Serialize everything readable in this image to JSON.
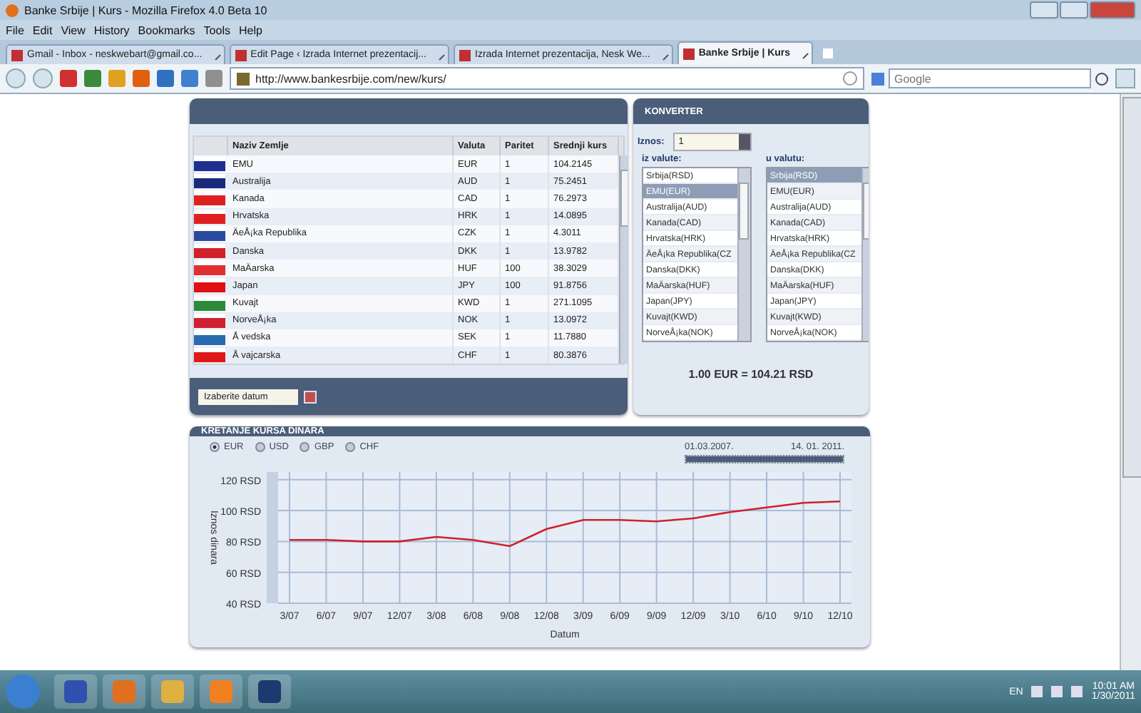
{
  "window": {
    "title": "Banke Srbije | Kurs - Mozilla Firefox 4.0 Beta 10"
  },
  "menu": [
    "File",
    "Edit",
    "View",
    "History",
    "Bookmarks",
    "Tools",
    "Help"
  ],
  "tabs": [
    {
      "label": "Gmail - Inbox - neskwebart@gmail.co...",
      "selected": false
    },
    {
      "label": "Edit Page ‹ Izrada Internet prezentacij...",
      "selected": false
    },
    {
      "label": "Izrada Internet prezentacija, Nesk We...",
      "selected": false
    },
    {
      "label": "Banke Srbije | Kurs",
      "selected": true
    }
  ],
  "address": {
    "url": "http://www.bankesrbije.com/new/kurs/"
  },
  "search": {
    "placeholder": "Google"
  },
  "rates": {
    "columns": [
      "Naziv Zemlje",
      "Valuta",
      "Paritet",
      "Srednji kurs"
    ],
    "rows": [
      {
        "country": "EMU",
        "currency": "EUR",
        "parity": "1",
        "rate": "104.2145",
        "color": "#1f2f8f"
      },
      {
        "country": "Australija",
        "currency": "AUD",
        "parity": "1",
        "rate": "75.2451",
        "color": "#1a2a7a"
      },
      {
        "country": "Kanada",
        "currency": "CAD",
        "parity": "1",
        "rate": "76.2973",
        "color": "#e02020"
      },
      {
        "country": "Hrvatska",
        "currency": "HRK",
        "parity": "1",
        "rate": "14.0895",
        "color": "#e02020"
      },
      {
        "country": "ÄeÅ¡ka Republika",
        "currency": "CZK",
        "parity": "1",
        "rate": "4.3011",
        "color": "#2a4aa0"
      },
      {
        "country": "Danska",
        "currency": "DKK",
        "parity": "1",
        "rate": "13.9782",
        "color": "#d0202a"
      },
      {
        "country": "MaÄarska",
        "currency": "HUF",
        "parity": "100",
        "rate": "38.3029",
        "color": "#e03030"
      },
      {
        "country": "Japan",
        "currency": "JPY",
        "parity": "100",
        "rate": "91.8756",
        "color": "#e01010"
      },
      {
        "country": "Kuvajt",
        "currency": "KWD",
        "parity": "1",
        "rate": "271.1095",
        "color": "#2a8a3a"
      },
      {
        "country": "NorveÅ¡ka",
        "currency": "NOK",
        "parity": "1",
        "rate": "13.0972",
        "color": "#d02030"
      },
      {
        "country": "Å vedska",
        "currency": "SEK",
        "parity": "1",
        "rate": "11.7880",
        "color": "#2a6ab0"
      },
      {
        "country": "Å vajcarska",
        "currency": "CHF",
        "parity": "1",
        "rate": "80.3876",
        "color": "#e01818"
      }
    ],
    "date_field": {
      "value": "Izaberite datum"
    }
  },
  "converter": {
    "title": "KONVERTER",
    "amount_label": "Iznos:",
    "amount": "1",
    "from_label": "iz valute:",
    "to_label": "u valutu:",
    "from": [
      {
        "label": "Srbija(RSD)",
        "selected": false
      },
      {
        "label": "EMU(EUR)",
        "selected": true
      },
      {
        "label": "Australija(AUD)",
        "selected": false
      },
      {
        "label": "Kanada(CAD)",
        "selected": false
      },
      {
        "label": "Hrvatska(HRK)",
        "selected": false
      },
      {
        "label": "ÄeÅ¡ka Republika(CZ",
        "selected": false
      },
      {
        "label": "Danska(DKK)",
        "selected": false
      },
      {
        "label": "MaÄarska(HUF)",
        "selected": false
      },
      {
        "label": "Japan(JPY)",
        "selected": false
      },
      {
        "label": "Kuvajt(KWD)",
        "selected": false
      },
      {
        "label": "NorveÅ¡ka(NOK)",
        "selected": false
      }
    ],
    "to": [
      {
        "label": "Srbija(RSD)",
        "selected": true
      },
      {
        "label": "EMU(EUR)",
        "selected": false
      },
      {
        "label": "Australija(AUD)",
        "selected": false
      },
      {
        "label": "Kanada(CAD)",
        "selected": false
      },
      {
        "label": "Hrvatska(HRK)",
        "selected": false
      },
      {
        "label": "ÄeÅ¡ka Republika(CZ",
        "selected": false
      },
      {
        "label": "Danska(DKK)",
        "selected": false
      },
      {
        "label": "MaÄarska(HUF)",
        "selected": false
      },
      {
        "label": "Japan(JPY)",
        "selected": false
      },
      {
        "label": "Kuvajt(KWD)",
        "selected": false
      },
      {
        "label": "NorveÅ¡ka(NOK)",
        "selected": false
      }
    ],
    "result": "1.00 EUR = 104.21 RSD"
  },
  "history": {
    "title": "KRETANJE KURSA DINARA",
    "currencies": [
      {
        "label": "EUR",
        "selected": true
      },
      {
        "label": "USD",
        "selected": false
      },
      {
        "label": "GBP",
        "selected": false
      },
      {
        "label": "CHF",
        "selected": false
      }
    ],
    "range": {
      "start": "01.03.2007.",
      "end": "14. 01. 2011.",
      "level": 1
    },
    "chart_data": {
      "type": "line",
      "xlabel": "Datum",
      "ylabel": "Iznos dinara",
      "grid": true,
      "categories": [
        "3/07",
        "6/07",
        "9/07",
        "12/07",
        "3/08",
        "6/08",
        "9/08",
        "12/08",
        "3/09",
        "6/09",
        "9/09",
        "12/09",
        "3/10",
        "6/10",
        "9/10",
        "12/10"
      ],
      "series": [
        {
          "color": "#d0202a",
          "values": [
            81,
            81,
            80,
            80,
            83,
            81,
            77,
            88,
            94,
            94,
            93,
            95,
            99,
            102,
            105,
            106
          ]
        }
      ],
      "ylim": [
        40,
        125
      ],
      "yticks": [
        {
          "value": 40,
          "label": "40 RSD"
        },
        {
          "value": 60,
          "label": "60 RSD"
        },
        {
          "value": 80,
          "label": "80 RSD"
        },
        {
          "value": 100,
          "label": "100 RSD"
        },
        {
          "value": 120,
          "label": "120 RSD"
        }
      ]
    }
  },
  "taskbar": {
    "language": "EN",
    "time": "10:01 AM",
    "date": "1/30/2011"
  }
}
